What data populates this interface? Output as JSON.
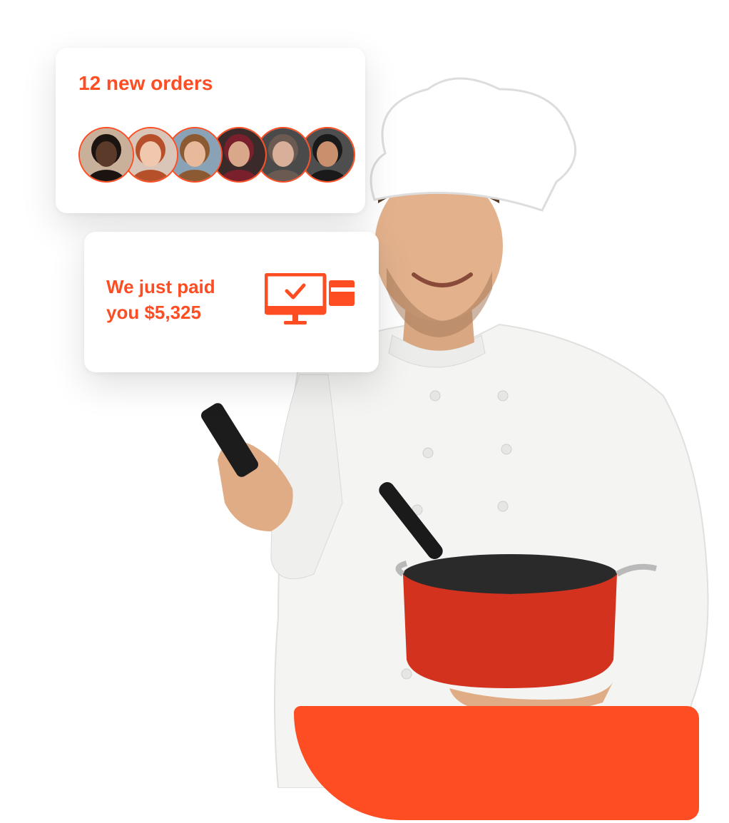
{
  "colors": {
    "accent": "#FF4D23",
    "card_background": "#FFFFFF"
  },
  "orders_card": {
    "title": "12 new orders",
    "avatars": [
      {
        "icon": "customer-avatar",
        "skin": "#5b3a2a",
        "hair": "#1b1410",
        "bg": "#c9b09a"
      },
      {
        "icon": "customer-avatar",
        "skin": "#f0c8ae",
        "hair": "#b5502a",
        "bg": "#d9c6b8"
      },
      {
        "icon": "customer-avatar",
        "skin": "#e8b99a",
        "hair": "#8b5a32",
        "bg": "#8aa2b5"
      },
      {
        "icon": "customer-avatar",
        "skin": "#d9a78a",
        "hair": "#7a1f2c",
        "bg": "#3a2a2a"
      },
      {
        "icon": "customer-avatar",
        "skin": "#d8b09a",
        "hair": "#6a5a52",
        "bg": "#4a4a4a"
      },
      {
        "icon": "customer-avatar",
        "skin": "#c9906e",
        "hair": "#1a1a1a",
        "bg": "#4e4e4e"
      }
    ]
  },
  "payment_card": {
    "line1": "We just paid",
    "line2": "you $5,325",
    "icon": "monitor-checkmark-card-icon"
  },
  "illustration": {
    "subject": "chef-photo"
  }
}
